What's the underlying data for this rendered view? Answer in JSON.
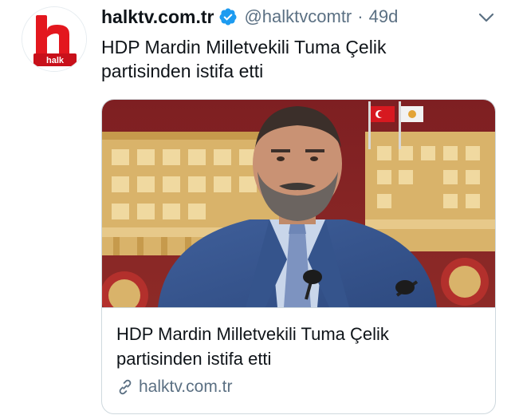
{
  "author": {
    "display_name": "halktv.com.tr",
    "handle": "@halktvcomtr",
    "separator": "·",
    "time": "49d",
    "verified": true,
    "avatar_text": "halk",
    "brand_color": "#e3171e"
  },
  "tweet": {
    "text_lines": [
      "HDP Mardin Milletvekili Tuma Çelik",
      "partisinden istifa etti"
    ]
  },
  "card": {
    "title_lines": [
      "HDP Mardin Milletvekili Tuma Çelik",
      "partisinden istifa etti"
    ],
    "domain": "halktv.com.tr"
  },
  "icons": {
    "verified": "verified-badge-icon",
    "more": "chevron-down-icon",
    "link": "link-icon"
  },
  "colors": {
    "verified_blue": "#1d9bf0",
    "secondary_text": "#5b7083",
    "card_border": "#cfd9de"
  }
}
